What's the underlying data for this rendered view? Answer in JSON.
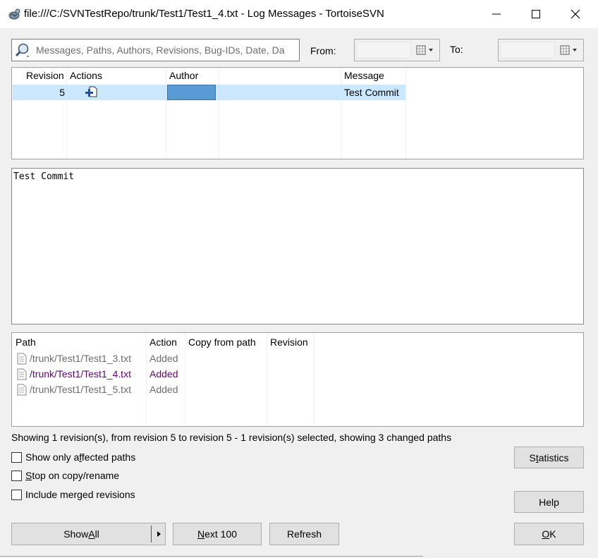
{
  "window": {
    "title": "file:///C:/SVNTestRepo/trunk/Test1/Test1_4.txt - Log Messages - TortoiseSVN",
    "app_icon": "tortoise-icon",
    "controls": [
      "minimize-icon",
      "maximize-icon",
      "close-icon"
    ]
  },
  "filter": {
    "search_placeholder": "Messages, Paths, Authors, Revisions, Bug-IDs, Date, Da",
    "search_icon": "search-icon",
    "from_label": "From:",
    "to_label": "To:",
    "from_value": "",
    "to_value": ""
  },
  "log_table": {
    "columns": [
      "Revision",
      "Actions",
      "Author",
      "",
      "Message"
    ],
    "rows": [
      {
        "revision": "5",
        "action_icon": "added-icon",
        "author": "",
        "date": "",
        "message": "Test Commit"
      }
    ]
  },
  "message_panel": {
    "text": "Test Commit"
  },
  "paths_table": {
    "columns": [
      "Path",
      "Action",
      "Copy from path",
      "Revision"
    ],
    "rows": [
      {
        "path": "/trunk/Test1/Test1_3.txt",
        "action": "Added",
        "highlight": false
      },
      {
        "path": "/trunk/Test1/Test1_4.txt",
        "action": "Added",
        "highlight": true
      },
      {
        "path": "/trunk/Test1/Test1_5.txt",
        "action": "Added",
        "highlight": false
      }
    ]
  },
  "status_text": "Showing 1 revision(s), from revision 5 to revision 5 - 1 revision(s) selected, showing 3 changed paths",
  "options": {
    "affected_pre": "Show only a",
    "affected_key": "f",
    "affected_post": "fected paths",
    "stop_key": "S",
    "stop_post": "top on copy/rename",
    "merged_label": "Include merged revisions"
  },
  "buttons": {
    "statistics_pre": "S",
    "statistics_key": "t",
    "statistics_post": "atistics",
    "help": "Help",
    "show_all_pre": "Show ",
    "show_all_key": "A",
    "show_all_post": "ll",
    "next_key": "N",
    "next_post": "ext 100",
    "refresh": "Refresh",
    "ok_key": "O",
    "ok_post": "K"
  },
  "colors": {
    "selection": "#cce8ff",
    "author_cell": "#5b9bd5",
    "highlight_path": "#5c0a6e",
    "dim_text": "#6d6d6d"
  }
}
